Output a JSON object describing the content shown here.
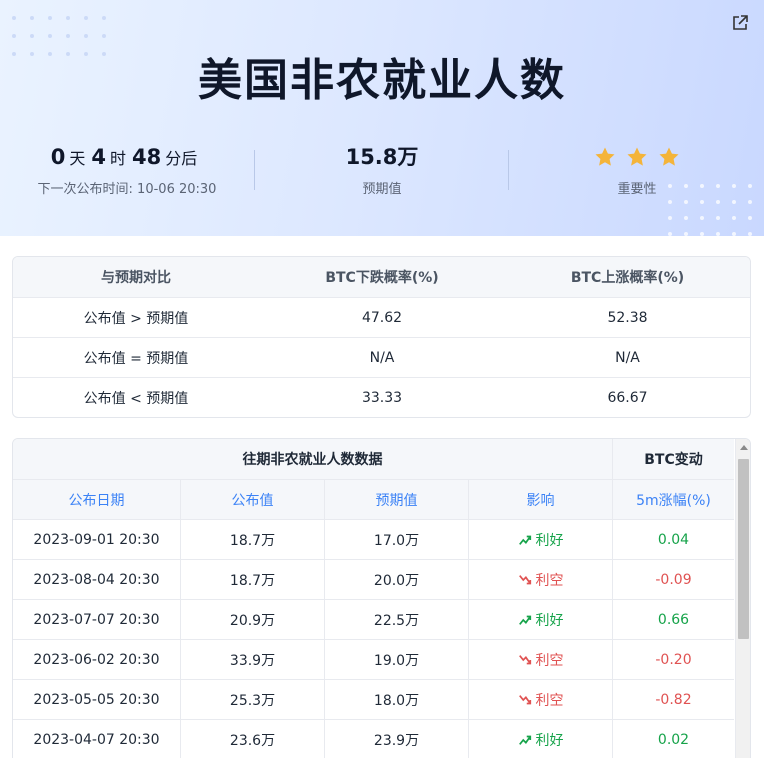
{
  "header": {
    "title": "美国非农就业人数",
    "countdown": {
      "days": "0",
      "days_unit": "天",
      "hours": "4",
      "hours_unit": "时",
      "minutes": "48",
      "minutes_unit": "分后"
    },
    "next_release_label": "下一次公布时间: 10-06 20:30",
    "forecast_value": "15.8万",
    "forecast_label": "预期值",
    "importance_stars": 3,
    "importance_label": "重要性",
    "share_icon": "share-icon"
  },
  "probability": {
    "headers": [
      "与预期对比",
      "BTC下跌概率(%)",
      "BTC上涨概率(%)"
    ],
    "rows": [
      {
        "label": "公布值 > 预期值",
        "down": "47.62",
        "up": "52.38"
      },
      {
        "label": "公布值 = 预期值",
        "down": "N/A",
        "up": "N/A"
      },
      {
        "label": "公布值 < 预期值",
        "down": "33.33",
        "up": "66.67"
      }
    ]
  },
  "history": {
    "group_title": "往期非农就业人数数据",
    "btc_title": "BTC变动",
    "columns": [
      "公布日期",
      "公布值",
      "预期值",
      "影响",
      "5m涨幅(%)"
    ],
    "rows": [
      {
        "date": "2023-09-01 20:30",
        "actual": "18.7万",
        "forecast": "17.0万",
        "impact": "利好",
        "impact_type": "good",
        "change": "0.04"
      },
      {
        "date": "2023-08-04 20:30",
        "actual": "18.7万",
        "forecast": "20.0万",
        "impact": "利空",
        "impact_type": "bad",
        "change": "-0.09"
      },
      {
        "date": "2023-07-07 20:30",
        "actual": "20.9万",
        "forecast": "22.5万",
        "impact": "利好",
        "impact_type": "good",
        "change": "0.66"
      },
      {
        "date": "2023-06-02 20:30",
        "actual": "33.9万",
        "forecast": "19.0万",
        "impact": "利空",
        "impact_type": "bad",
        "change": "-0.20"
      },
      {
        "date": "2023-05-05 20:30",
        "actual": "25.3万",
        "forecast": "18.0万",
        "impact": "利空",
        "impact_type": "bad",
        "change": "-0.82"
      },
      {
        "date": "2023-04-07 20:30",
        "actual": "23.6万",
        "forecast": "23.9万",
        "impact": "利好",
        "impact_type": "good",
        "change": "0.02"
      }
    ]
  },
  "colors": {
    "good": "#16a34a",
    "bad": "#e05252",
    "star": "#f4b43a",
    "accent": "#3b82f6"
  }
}
